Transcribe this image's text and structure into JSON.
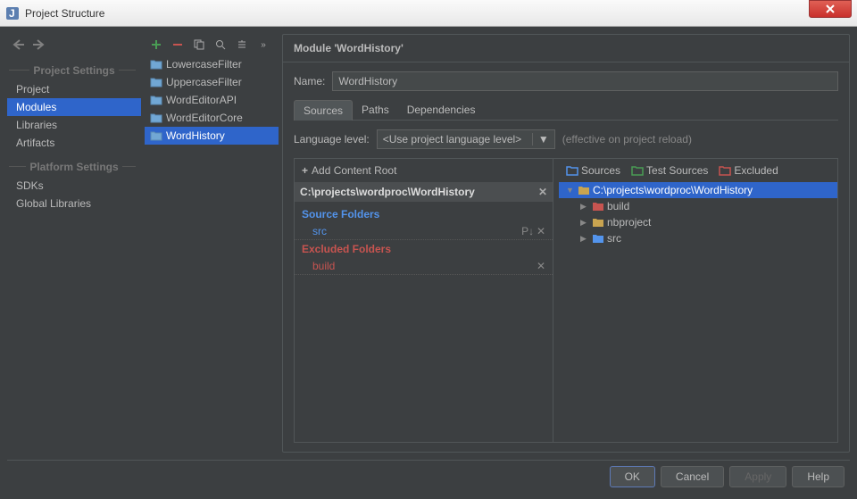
{
  "window": {
    "title": "Project Structure"
  },
  "sidebar": {
    "section1": "Project Settings",
    "section2": "Platform Settings",
    "items1": [
      "Project",
      "Modules",
      "Libraries",
      "Artifacts"
    ],
    "items2": [
      "SDKs",
      "Global Libraries"
    ],
    "selected": "Modules"
  },
  "modules": {
    "items": [
      "LowercaseFilter",
      "UppercaseFilter",
      "WordEditorAPI",
      "WordEditorCore",
      "WordHistory"
    ],
    "selected": "WordHistory"
  },
  "panel": {
    "title": "Module 'WordHistory'",
    "name_label": "Name:",
    "name_value": "WordHistory",
    "tabs": [
      "Sources",
      "Paths",
      "Dependencies"
    ],
    "lang_label": "Language level:",
    "lang_value": "<Use project language level>",
    "lang_hint": "(effective on project reload)",
    "add_root": "Add Content Root",
    "root_path": "C:\\projects\\wordproc\\WordHistory",
    "src_hdr": "Source Folders",
    "src_items": [
      "src"
    ],
    "excl_hdr": "Excluded Folders",
    "excl_items": [
      "build"
    ],
    "legend": {
      "sources": "Sources",
      "tests": "Test Sources",
      "excluded": "Excluded"
    },
    "tree": {
      "root": "C:\\projects\\wordproc\\WordHistory",
      "children": [
        "build",
        "nbproject",
        "src"
      ]
    }
  },
  "footer": {
    "ok": "OK",
    "cancel": "Cancel",
    "apply": "Apply",
    "help": "Help"
  },
  "colors": {
    "src": "#5394ec",
    "test": "#499c54",
    "excl": "#c75450",
    "folder": "#c9a450"
  }
}
